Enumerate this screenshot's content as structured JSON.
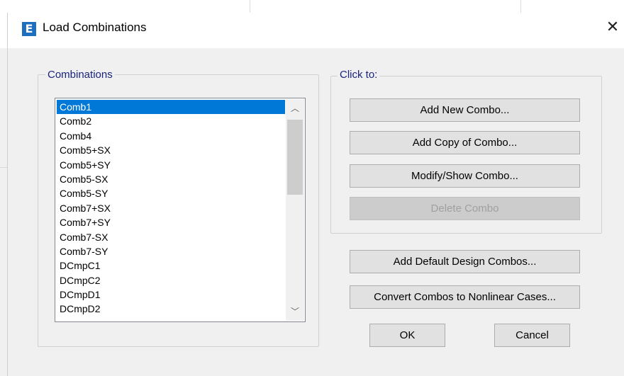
{
  "window": {
    "title": "Load Combinations",
    "icon_letter": "E",
    "close_glyph": "✕"
  },
  "groups": {
    "combinations_label": "Combinations",
    "click_to_label": "Click to:"
  },
  "list": {
    "selected_index": 0,
    "items": [
      "Comb1",
      "Comb2",
      "Comb4",
      "Comb5+SX",
      "Comb5+SY",
      "Comb5-SX",
      "Comb5-SY",
      "Comb7+SX",
      "Comb7+SY",
      "Comb7-SX",
      "Comb7-SY",
      "DCmpC1",
      "DCmpC2",
      "DCmpD1",
      "DCmpD2"
    ],
    "scroll_up_glyph": "︿",
    "scroll_down_glyph": "﹀"
  },
  "buttons": {
    "add_new": "Add New Combo...",
    "add_copy": "Add Copy of Combo...",
    "modify_show": "Modify/Show Combo...",
    "delete": "Delete Combo",
    "add_default": "Add Default Design Combos...",
    "convert": "Convert Combos to Nonlinear Cases...",
    "ok": "OK",
    "cancel": "Cancel"
  },
  "colors": {
    "selection": "#0078d7",
    "icon": "#1f6fc1",
    "group_label": "#1a237e"
  },
  "icons": [
    "app-icon",
    "close-icon",
    "scroll-up-icon",
    "scroll-down-icon"
  ]
}
